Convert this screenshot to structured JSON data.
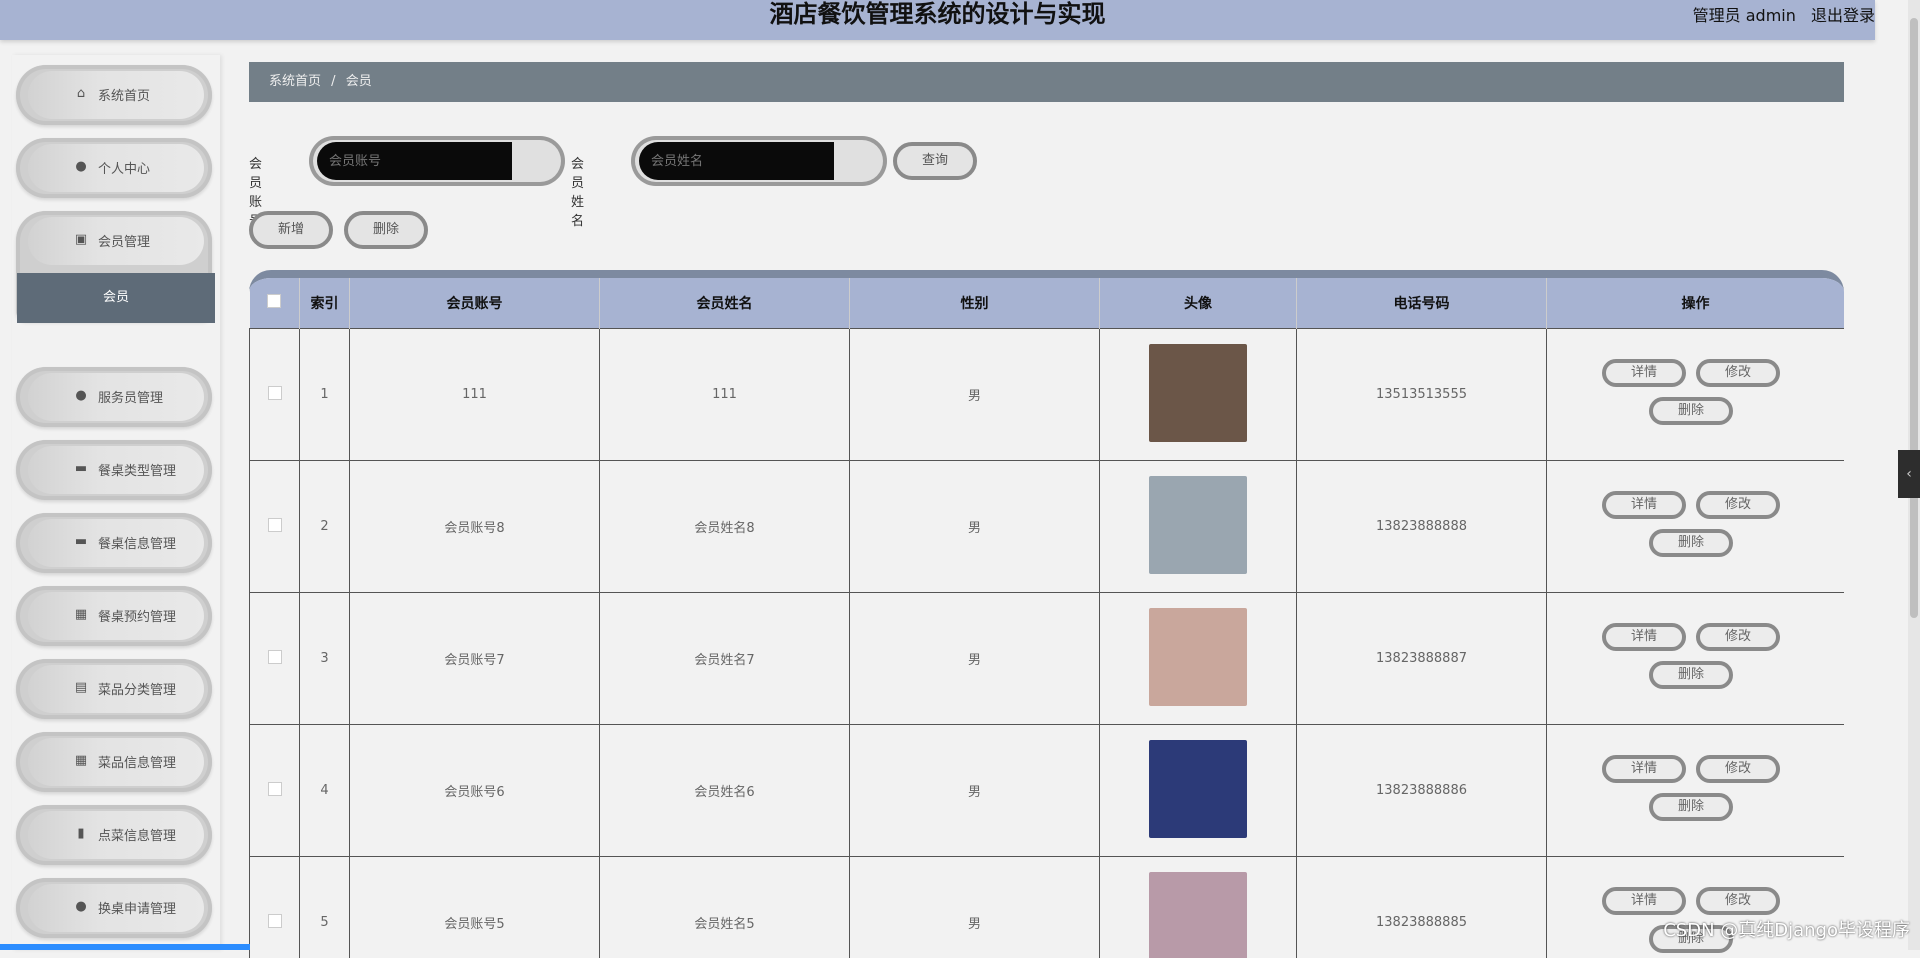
{
  "header": {
    "title": "酒店餐饮管理系统的设计与实现",
    "user_label": "管理员 admin",
    "logout": "退出登录"
  },
  "sidebar": {
    "items": [
      {
        "label": "系统首页",
        "icon": "home-icon",
        "glyph": "⌂"
      },
      {
        "label": "个人中心",
        "icon": "user-icon",
        "glyph": "●"
      },
      {
        "label": "会员管理",
        "icon": "clipboard-icon",
        "glyph": "▣"
      },
      {
        "label": "服务员管理",
        "icon": "user-icon",
        "glyph": "●"
      },
      {
        "label": "餐桌类型管理",
        "icon": "table-icon",
        "glyph": "▬"
      },
      {
        "label": "餐桌信息管理",
        "icon": "table-icon",
        "glyph": "▬"
      },
      {
        "label": "餐桌预约管理",
        "icon": "grid-icon",
        "glyph": "▦"
      },
      {
        "label": "菜品分类管理",
        "icon": "clipboard-icon",
        "glyph": "▤"
      },
      {
        "label": "菜品信息管理",
        "icon": "grid-icon",
        "glyph": "▦"
      },
      {
        "label": "点菜信息管理",
        "icon": "bar-chart-icon",
        "glyph": "▮"
      },
      {
        "label": "换桌申请管理",
        "icon": "user-icon",
        "glyph": "●"
      }
    ],
    "active_sub": "会员"
  },
  "breadcrumb": {
    "home": "系统首页",
    "current": "会员",
    "sep": "/"
  },
  "search": {
    "account_label": "会员账号",
    "account_placeholder": "会员账号",
    "name_label": "会员姓名",
    "name_placeholder": "会员姓名",
    "query": "查询"
  },
  "actions": {
    "add": "新增",
    "delete": "删除"
  },
  "table": {
    "headers": [
      "索引",
      "会员账号",
      "会员姓名",
      "性别",
      "头像",
      "电话号码",
      "操作"
    ],
    "rows": [
      {
        "index": "1",
        "account": "111",
        "name": "111",
        "gender": "男",
        "phone": "13513513555",
        "avatar_color": "#6b5648"
      },
      {
        "index": "2",
        "account": "会员账号8",
        "name": "会员姓名8",
        "gender": "男",
        "phone": "13823888888",
        "avatar_color": "#9aa6b0"
      },
      {
        "index": "3",
        "account": "会员账号7",
        "name": "会员姓名7",
        "gender": "男",
        "phone": "13823888887",
        "avatar_color": "#c9a79c"
      },
      {
        "index": "4",
        "account": "会员账号6",
        "name": "会员姓名6",
        "gender": "男",
        "phone": "13823888886",
        "avatar_color": "#2c3a78"
      },
      {
        "index": "5",
        "account": "会员账号5",
        "name": "会员姓名5",
        "gender": "男",
        "phone": "13823888885",
        "avatar_color": "#b89aa8"
      }
    ],
    "ops": {
      "detail": "详情",
      "edit": "修改",
      "delete": "删除"
    }
  },
  "watermark": "CSDN @真纯Django毕设程序",
  "side_tab_glyph": "‹"
}
